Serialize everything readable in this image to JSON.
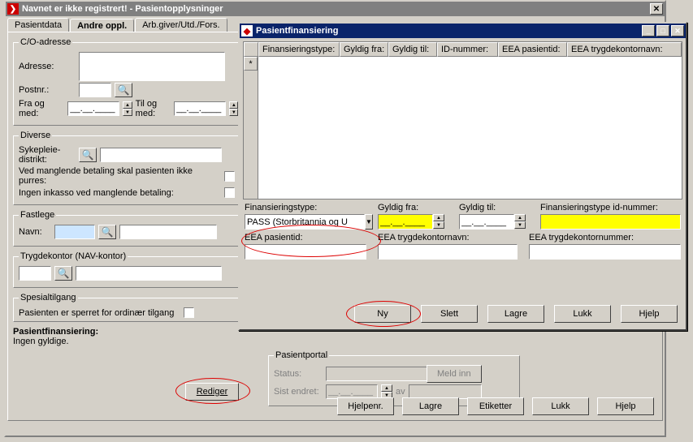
{
  "main_window": {
    "title": "Navnet er ikke registrert! - Pasientopplysninger",
    "tabs": {
      "t0": "Pasientdata",
      "t1": "Andre oppl.",
      "t2": "Arb.giver/Utd./Fors."
    },
    "co_adresse": {
      "legend": "C/O-adresse",
      "adresse_label": "Adresse:",
      "postnr_label": "Postnr.:",
      "fra_label": "Fra og med:",
      "til_label": "Til og med:",
      "fra_value": "__.__.____",
      "til_value": "__.__.____"
    },
    "diverse": {
      "legend": "Diverse",
      "sykepleie_label": "Sykepleie-\ndistrikt:",
      "purres_label": "Ved manglende betaling skal pasienten ikke purres:",
      "inkasso_label": "Ingen inkasso ved manglende betaling:"
    },
    "fastlege": {
      "legend": "Fastlege",
      "navn_label": "Navn:"
    },
    "trygdekontor": {
      "legend": "Trygdekontor (NAV-kontor)"
    },
    "spesial": {
      "legend": "Spesialtilgang",
      "sperret_label": "Pasienten er sperret for ordinær tilgang"
    },
    "pf": {
      "legend": "Pasientfinansiering:",
      "text": "Ingen gyldige."
    },
    "rediger_label": "Rediger",
    "portal": {
      "legend": "Pasientportal",
      "status_label": "Status:",
      "meld_label": "Meld inn",
      "sist_label": "Sist endret:",
      "sist_value": "__.__.____",
      "av_label": "av"
    },
    "buttons": {
      "hjelpenr": "Hjelpenr.",
      "lagre": "Lagre",
      "etiketter": "Etiketter",
      "lukk": "Lukk",
      "hjelp": "Hjelp"
    }
  },
  "popup": {
    "title": "Pasientfinansiering",
    "grid_headers": {
      "c0": "Finansieringstype:",
      "c1": "Gyldig fra:",
      "c2": "Gyldig til:",
      "c3": "ID-nummer:",
      "c4": "EEA pasientid:",
      "c5": "EEA trygdekontornavn:"
    },
    "grid_star": "*",
    "form": {
      "fin_label": "Finansieringstype:",
      "fin_value": "PASS (Storbritannia og U",
      "gfra_label": "Gyldig fra:",
      "gfra_value": "__.__.____",
      "gtil_label": "Gyldig til:",
      "gtil_value": "__.__.____",
      "id_label": "Finansieringstype id-nummer:",
      "eeap_label": "EEA pasientid:",
      "eeanavn_label": "EEA trygdekontornavn:",
      "eeanr_label": "EEA trygdekontornummer:"
    },
    "buttons": {
      "ny": "Ny",
      "slett": "Slett",
      "lagre": "Lagre",
      "lukk": "Lukk",
      "hjelp": "Hjelp"
    }
  }
}
